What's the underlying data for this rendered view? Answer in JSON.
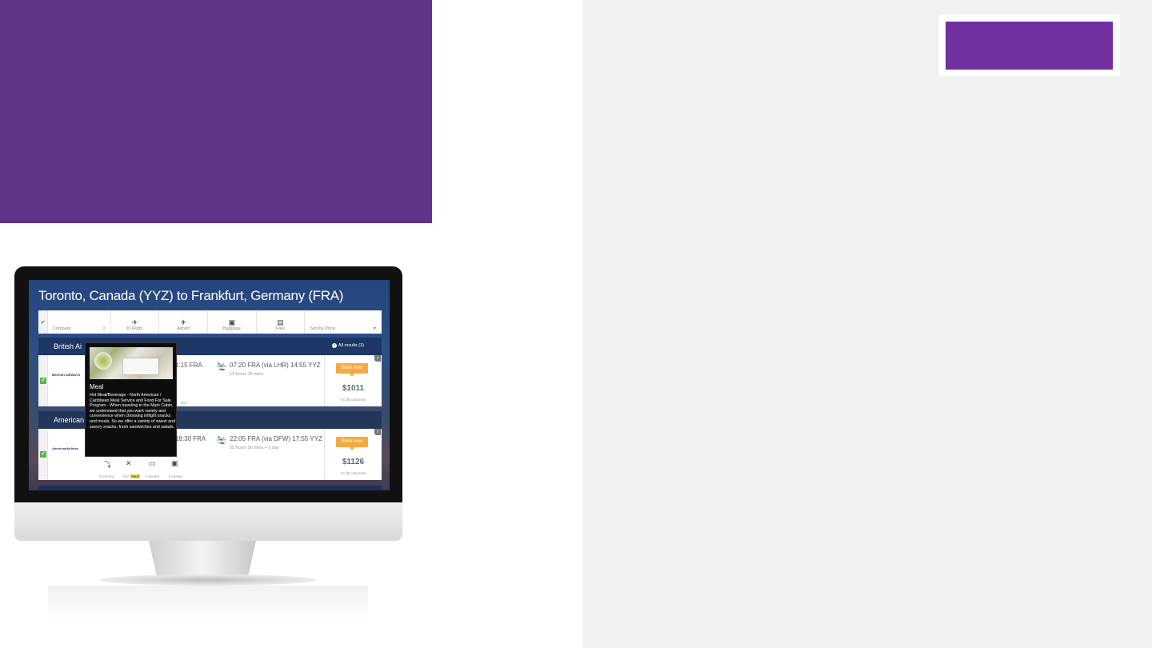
{
  "colors": {
    "banner": "#5f3387",
    "panel": "#f1f1f1",
    "accent": "#7030a0",
    "book_button": "#f5a940",
    "check": "#56b949"
  },
  "screen": {
    "title": "Toronto, Canada (YYZ) to Frankfurt, Germany (FRA)",
    "toolbar": {
      "check_icon": "check-icon",
      "compare_label": "Compare",
      "compare_count": "2",
      "items": [
        {
          "icon": "plane-icon",
          "glyph": "✈",
          "label": "In Flight"
        },
        {
          "icon": "airport-icon",
          "glyph": "✈",
          "label": "Airport"
        },
        {
          "icon": "baggage-icon",
          "glyph": "▣",
          "label": "Baggage"
        },
        {
          "icon": "fare-icon",
          "glyph": "▤",
          "label": "Fare"
        }
      ],
      "sort_label": "Sort by Price",
      "sort_arrow": "▼"
    },
    "groups": [
      {
        "name": "British Ai",
        "all_results": "All results (3)",
        "all_results_icon": "+",
        "card": {
          "airline": "BRITISH AIRWAYS",
          "outbound": "1:15 FRA",
          "return_icon": "landing-icon",
          "return_glyph": "🛬",
          "return": "07:20 FRA (via LHR) 14:55 YYZ",
          "duration": "13 hours 35 mins",
          "book": "Book now",
          "price": "$1011",
          "fees": "Inc.$0 optionals",
          "info": "i",
          "amenity_label": "ded"
        }
      },
      {
        "name": "American",
        "card": {
          "airline": "AmericanAirlines",
          "outbound": "18:30 FRA",
          "return_icon": "landing-icon",
          "return_glyph": "🛬",
          "return": "22:05 FRA (via DFW) 17:55 YYZ",
          "duration": "25 hours 50 mins + 1 day",
          "book": "Book now",
          "price": "$1126",
          "fees": "Inc.$0 optionals",
          "info": "i",
          "amenities": [
            {
              "icon": "seat-icon",
              "glyph": "⤵",
              "label": "Economy"
            },
            {
              "icon": "meal-icon",
              "glyph": "✕",
              "label": "Incl"
            },
            {
              "icon": "tv-icon",
              "glyph": "▭",
              "label": "Included"
            },
            {
              "icon": "luggage-icon",
              "glyph": "▣",
              "label": "Included"
            }
          ],
          "meal_chip": "Meal"
        }
      }
    ],
    "tooltip": {
      "title": "Meal",
      "body": "Hot Meal/Beverage - North American / Caribbean Meal Service and Food For Sale Program - When traveling in the Main Cabin, we understand that you want variety and convenience when choosing inflight snacks and meals. So we offer a variety of sweet and savory snacks, fresh sandwiches and salads."
    }
  }
}
